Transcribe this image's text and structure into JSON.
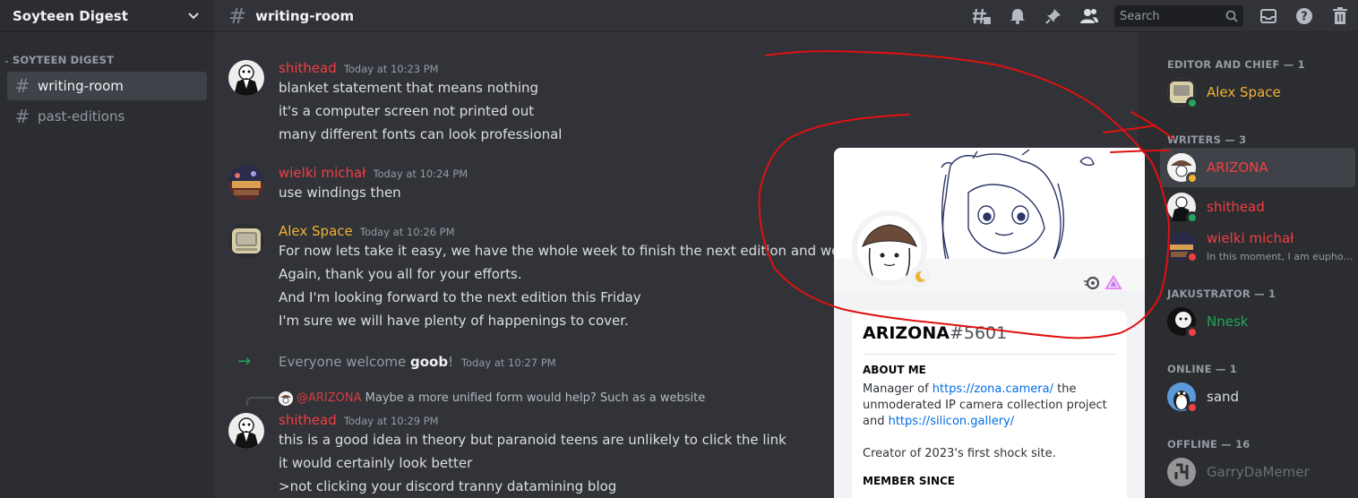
{
  "server": {
    "name": "Soyteen Digest"
  },
  "sidebar": {
    "category": "SOYTEEN DIGEST",
    "channels": [
      {
        "label": "writing-room",
        "active": true
      },
      {
        "label": "past-editions",
        "active": false
      }
    ]
  },
  "header": {
    "channel_name": "writing-room",
    "search_placeholder": "Search",
    "icons": [
      "threads-icon",
      "bell-icon",
      "pin-icon",
      "members-icon",
      "inbox-icon",
      "help-icon",
      "trash-icon"
    ]
  },
  "messages": [
    {
      "author": "shithead",
      "time": "Today at 10:23 PM",
      "lines": [
        "blanket statement that means nothing",
        "it's a computer screen not printed out",
        "many different fonts can look professional"
      ]
    },
    {
      "author": "wielki michał",
      "time": "Today at 10:24 PM",
      "lines": [
        "use windings then"
      ]
    },
    {
      "author": "Alex Space",
      "time": "Today at 10:26 PM",
      "lines": [
        "For now lets take it easy, we have the whole week to finish the next edition and we and enjoy",
        "Again, thank you all for your efforts.",
        "And I'm looking forward to the next edition this Friday",
        "I'm sure we will have plenty of happenings to cover."
      ]
    },
    {
      "system": true,
      "prefix": "Everyone welcome ",
      "user": "goob",
      "suffix": "!",
      "time": "Today at 10:27 PM"
    },
    {
      "reply_mention": "@ARIZONA",
      "reply_text": "Maybe a more unified form would help? Such as a website",
      "author": "shithead",
      "time": "Today at 10:29 PM",
      "lines": [
        "this is a good idea in theory but paranoid teens are unlikely to click the link",
        "it would certainly look better",
        ">not clicking your discord tranny datamining blog"
      ]
    }
  ],
  "members": {
    "groups": [
      {
        "title": "EDITOR AND CHIEF — 1",
        "members": [
          {
            "name": "Alex Space",
            "color": "#f0b232",
            "status": "online"
          }
        ]
      },
      {
        "title": "WRITERS — 3",
        "members": [
          {
            "name": "ARIZONA",
            "color": "#f23f42",
            "status": "idle",
            "selected": true
          },
          {
            "name": "shithead",
            "color": "#f23f42",
            "status": "online"
          },
          {
            "name": "wielki michał",
            "color": "#f23f42",
            "status": "dnd",
            "sub": "In this moment, I am euphoric..."
          }
        ]
      },
      {
        "title": "JAKUSTRATOR — 1",
        "members": [
          {
            "name": "Nnesk",
            "color": "#23a55a",
            "status": "dnd"
          }
        ]
      },
      {
        "title": "ONLINE — 1",
        "members": [
          {
            "name": "sand",
            "color": "#dbdee1",
            "status": "dnd"
          }
        ]
      },
      {
        "title": "OFFLINE — 16",
        "members": [
          {
            "name": "GarryDaMemer",
            "color": "#5c5e66",
            "status": "offline"
          }
        ]
      }
    ]
  },
  "profile": {
    "username": "ARIZONA",
    "discriminator": "#5601",
    "about_heading": "ABOUT ME",
    "about_prefix": "Manager of ",
    "about_link1": "https://zona.camera/",
    "about_mid": " the unmoderated IP camera collection project and ",
    "about_link2": "https://silicon.gallery/",
    "about_line2": "Creator of 2023's first shock site.",
    "member_since_heading": "MEMBER SINCE"
  },
  "colors": {
    "online": "#23a55a",
    "idle": "#f0b232",
    "dnd": "#f23f42",
    "annotation": "#e01010"
  }
}
